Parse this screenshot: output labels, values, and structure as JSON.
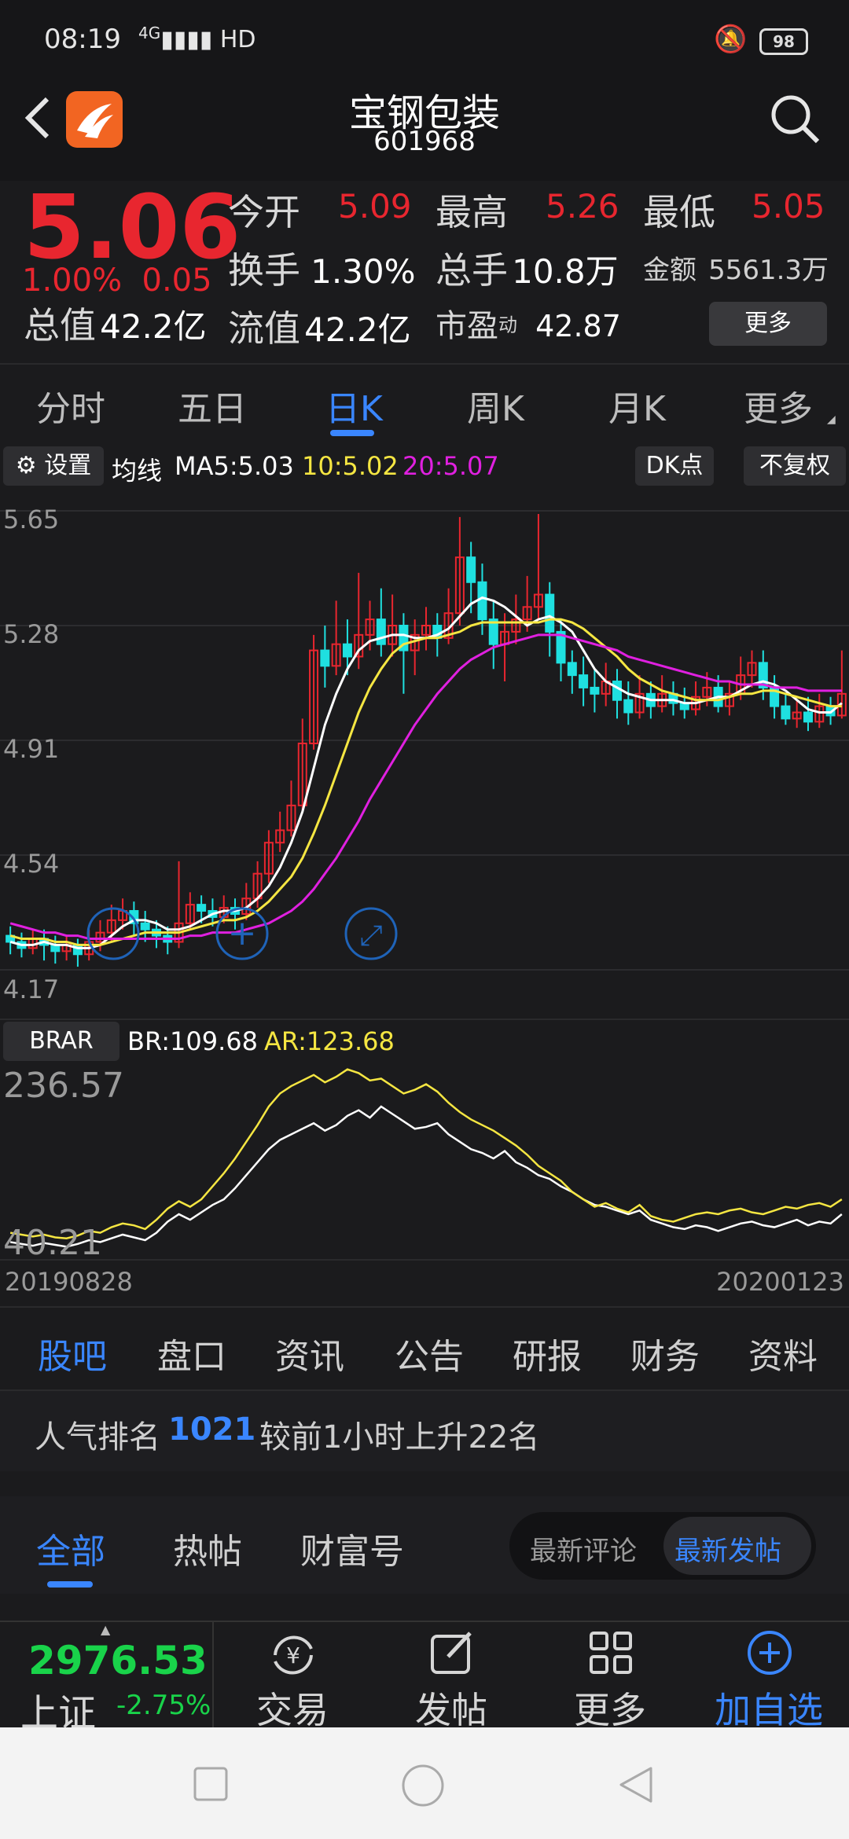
{
  "status": {
    "time": "08:19",
    "network": "4G",
    "signal_extra": "HD",
    "battery": "98"
  },
  "header": {
    "name": "宝钢包装",
    "code": "601968"
  },
  "quote": {
    "price": "5.06",
    "pct": "1.00%",
    "change": "0.05",
    "open_label": "今开",
    "open": "5.09",
    "high_label": "最高",
    "high": "5.26",
    "low_label": "最低",
    "low": "5.05",
    "turnover_label": "换手",
    "turnover": "1.30%",
    "volume_label": "总手",
    "volume": "10.8万",
    "amount_label": "金额",
    "amount": "5561.3万",
    "mcap_label": "总值",
    "mcap": "42.2亿",
    "float_label": "流值",
    "float": "42.2亿",
    "pe_label": "市盈",
    "pe_sup": "动",
    "pe": "42.87",
    "more": "更多"
  },
  "period_tabs": [
    "分时",
    "五日",
    "日K",
    "周K",
    "月K",
    "更多"
  ],
  "ma_bar": {
    "settings": "设置",
    "label": "均线",
    "ma5": "MA5:5.03",
    "ma10": "10:5.02",
    "ma20": "20:5.07",
    "dk": "DK点",
    "adjust": "不复权",
    "colors": {
      "ma5": "#ffffff",
      "ma10": "#f5e642",
      "ma20": "#e020e0"
    }
  },
  "chart_data": [
    {
      "type": "candlestick",
      "y_ticks": [
        "5.65",
        "5.28",
        "4.91",
        "4.54",
        "4.17"
      ],
      "ylim": [
        4.17,
        5.65
      ],
      "candles": [
        [
          4.28,
          4.26,
          4.31,
          4.22
        ],
        [
          4.26,
          4.24,
          4.29,
          4.21
        ],
        [
          4.24,
          4.27,
          4.3,
          4.22
        ],
        [
          4.27,
          4.25,
          4.3,
          4.2
        ],
        [
          4.25,
          4.23,
          4.28,
          4.19
        ],
        [
          4.23,
          4.25,
          4.28,
          4.2
        ],
        [
          4.25,
          4.22,
          4.27,
          4.18
        ],
        [
          4.22,
          4.26,
          4.3,
          4.2
        ],
        [
          4.26,
          4.29,
          4.33,
          4.23
        ],
        [
          4.29,
          4.33,
          4.38,
          4.26
        ],
        [
          4.33,
          4.36,
          4.4,
          4.3
        ],
        [
          4.36,
          4.32,
          4.39,
          4.28
        ],
        [
          4.32,
          4.3,
          4.36,
          4.26
        ],
        [
          4.3,
          4.28,
          4.33,
          4.24
        ],
        [
          4.28,
          4.26,
          4.31,
          4.22
        ],
        [
          4.26,
          4.32,
          4.52,
          4.24
        ],
        [
          4.32,
          4.38,
          4.42,
          4.3
        ],
        [
          4.38,
          4.36,
          4.41,
          4.32
        ],
        [
          4.36,
          4.34,
          4.4,
          4.31
        ],
        [
          4.34,
          4.37,
          4.41,
          4.32
        ],
        [
          4.37,
          4.35,
          4.4,
          4.3
        ],
        [
          4.35,
          4.4,
          4.45,
          4.33
        ],
        [
          4.4,
          4.48,
          4.52,
          4.37
        ],
        [
          4.48,
          4.58,
          4.62,
          4.45
        ],
        [
          4.58,
          4.62,
          4.68,
          4.55
        ],
        [
          4.62,
          4.7,
          4.78,
          4.6
        ],
        [
          4.7,
          4.9,
          4.98,
          4.68
        ],
        [
          4.9,
          5.2,
          5.25,
          4.88
        ],
        [
          5.2,
          5.15,
          5.28,
          5.08
        ],
        [
          5.15,
          5.22,
          5.36,
          5.12
        ],
        [
          5.22,
          5.18,
          5.3,
          5.12
        ],
        [
          5.18,
          5.25,
          5.45,
          5.14
        ],
        [
          5.25,
          5.3,
          5.36,
          5.2
        ],
        [
          5.3,
          5.22,
          5.4,
          5.18
        ],
        [
          5.22,
          5.28,
          5.38,
          5.18
        ],
        [
          5.28,
          5.2,
          5.32,
          5.06
        ],
        [
          5.2,
          5.25,
          5.3,
          5.12
        ],
        [
          5.25,
          5.28,
          5.34,
          5.2
        ],
        [
          5.28,
          5.24,
          5.32,
          5.18
        ],
        [
          5.24,
          5.32,
          5.4,
          5.22
        ],
        [
          5.32,
          5.5,
          5.63,
          5.28
        ],
        [
          5.5,
          5.42,
          5.55,
          5.32
        ],
        [
          5.42,
          5.3,
          5.48,
          5.25
        ],
        [
          5.3,
          5.22,
          5.36,
          5.14
        ],
        [
          5.22,
          5.26,
          5.32,
          5.1
        ],
        [
          5.26,
          5.3,
          5.38,
          5.22
        ],
        [
          5.3,
          5.34,
          5.44,
          5.26
        ],
        [
          5.34,
          5.38,
          5.64,
          5.3
        ],
        [
          5.38,
          5.26,
          5.42,
          5.18
        ],
        [
          5.26,
          5.16,
          5.3,
          5.1
        ],
        [
          5.16,
          5.12,
          5.2,
          5.06
        ],
        [
          5.12,
          5.08,
          5.18,
          5.02
        ],
        [
          5.08,
          5.06,
          5.14,
          5.0
        ],
        [
          5.06,
          5.1,
          5.16,
          5.02
        ],
        [
          5.1,
          5.04,
          5.14,
          4.98
        ],
        [
          5.04,
          5.0,
          5.1,
          4.96
        ],
        [
          5.0,
          5.06,
          5.12,
          4.98
        ],
        [
          5.06,
          5.02,
          5.1,
          4.98
        ],
        [
          5.02,
          5.06,
          5.12,
          5.0
        ],
        [
          5.06,
          5.03,
          5.1,
          4.99
        ],
        [
          5.03,
          5.01,
          5.08,
          4.98
        ],
        [
          5.01,
          5.05,
          5.1,
          4.99
        ],
        [
          5.05,
          5.08,
          5.13,
          5.02
        ],
        [
          5.08,
          5.02,
          5.12,
          5.0
        ],
        [
          5.02,
          5.06,
          5.1,
          4.99
        ],
        [
          5.06,
          5.12,
          5.18,
          5.04
        ],
        [
          5.12,
          5.16,
          5.2,
          5.08
        ],
        [
          5.16,
          5.08,
          5.2,
          5.04
        ],
        [
          5.08,
          5.02,
          5.12,
          4.98
        ],
        [
          5.02,
          4.98,
          5.06,
          4.96
        ],
        [
          4.98,
          5.0,
          5.04,
          4.95
        ],
        [
          5.0,
          4.97,
          5.05,
          4.94
        ],
        [
          4.97,
          5.02,
          5.06,
          4.95
        ],
        [
          5.02,
          4.99,
          5.05,
          4.96
        ],
        [
          4.99,
          5.06,
          5.2,
          4.98
        ]
      ],
      "series": [
        {
          "name": "MA5",
          "color": "#ffffff",
          "values": [
            4.26,
            4.25,
            4.25,
            4.26,
            4.25,
            4.25,
            4.24,
            4.24,
            4.25,
            4.28,
            4.31,
            4.33,
            4.33,
            4.32,
            4.3,
            4.3,
            4.31,
            4.33,
            4.35,
            4.36,
            4.36,
            4.37,
            4.4,
            4.44,
            4.5,
            4.58,
            4.68,
            4.82,
            4.96,
            5.06,
            5.14,
            5.2,
            5.23,
            5.24,
            5.25,
            5.25,
            5.24,
            5.24,
            5.25,
            5.27,
            5.31,
            5.35,
            5.37,
            5.36,
            5.34,
            5.31,
            5.28,
            5.3,
            5.31,
            5.29,
            5.26,
            5.2,
            5.14,
            5.1,
            5.08,
            5.06,
            5.05,
            5.04,
            5.04,
            5.04,
            5.03,
            5.03,
            5.04,
            5.05,
            5.05,
            5.07,
            5.09,
            5.1,
            5.09,
            5.07,
            5.04,
            5.01,
            5.0,
            5.0,
            5.03
          ]
        },
        {
          "name": "MA10",
          "color": "#f5e642",
          "values": [
            4.28,
            4.27,
            4.27,
            4.27,
            4.26,
            4.26,
            4.25,
            4.25,
            4.25,
            4.26,
            4.27,
            4.28,
            4.29,
            4.29,
            4.29,
            4.29,
            4.3,
            4.31,
            4.32,
            4.33,
            4.33,
            4.34,
            4.36,
            4.39,
            4.43,
            4.47,
            4.53,
            4.61,
            4.7,
            4.8,
            4.9,
            5.0,
            5.08,
            5.14,
            5.19,
            5.22,
            5.23,
            5.24,
            5.24,
            5.25,
            5.26,
            5.28,
            5.29,
            5.29,
            5.29,
            5.29,
            5.29,
            5.29,
            5.3,
            5.3,
            5.29,
            5.27,
            5.24,
            5.21,
            5.18,
            5.14,
            5.11,
            5.09,
            5.07,
            5.06,
            5.05,
            5.04,
            5.04,
            5.04,
            5.05,
            5.06,
            5.06,
            5.07,
            5.07,
            5.06,
            5.05,
            5.04,
            5.03,
            5.02,
            5.02
          ]
        },
        {
          "name": "MA20",
          "color": "#e020e0",
          "values": [
            4.32,
            4.31,
            4.3,
            4.29,
            4.29,
            4.28,
            4.28,
            4.27,
            4.27,
            4.27,
            4.27,
            4.27,
            4.27,
            4.27,
            4.27,
            4.27,
            4.28,
            4.28,
            4.29,
            4.29,
            4.29,
            4.3,
            4.31,
            4.32,
            4.34,
            4.36,
            4.39,
            4.43,
            4.48,
            4.53,
            4.59,
            4.65,
            4.72,
            4.78,
            4.84,
            4.9,
            4.96,
            5.01,
            5.06,
            5.1,
            5.14,
            5.17,
            5.19,
            5.21,
            5.22,
            5.23,
            5.24,
            5.25,
            5.25,
            5.25,
            5.24,
            5.23,
            5.22,
            5.21,
            5.2,
            5.18,
            5.17,
            5.16,
            5.15,
            5.14,
            5.13,
            5.12,
            5.11,
            5.1,
            5.1,
            5.09,
            5.09,
            5.09,
            5.08,
            5.08,
            5.08,
            5.07,
            5.07,
            5.07,
            5.07
          ]
        }
      ]
    },
    {
      "type": "line",
      "indicator": "BRAR",
      "y_ticks": [
        "236.57",
        "40.21"
      ],
      "ylim": [
        40.21,
        236.57
      ],
      "series": [
        {
          "name": "BR",
          "color": "#ffffff",
          "values": [
            50,
            48,
            46,
            49,
            47,
            45,
            48,
            52,
            50,
            54,
            58,
            55,
            52,
            60,
            72,
            80,
            74,
            82,
            90,
            96,
            108,
            122,
            136,
            150,
            160,
            166,
            172,
            178,
            170,
            176,
            186,
            192,
            184,
            196,
            188,
            180,
            172,
            174,
            178,
            166,
            158,
            150,
            146,
            140,
            148,
            136,
            130,
            122,
            118,
            110,
            104,
            96,
            90,
            88,
            84,
            80,
            84,
            74,
            70,
            66,
            64,
            68,
            66,
            62,
            66,
            70,
            72,
            68,
            66,
            70,
            74,
            68,
            72,
            70,
            80
          ]
        },
        {
          "name": "AR",
          "color": "#f5e642",
          "values": [
            60,
            58,
            56,
            58,
            55,
            54,
            57,
            62,
            60,
            66,
            70,
            68,
            64,
            74,
            86,
            94,
            88,
            96,
            110,
            124,
            140,
            158,
            176,
            196,
            210,
            218,
            224,
            230,
            222,
            228,
            236,
            232,
            224,
            226,
            218,
            210,
            214,
            220,
            212,
            200,
            190,
            182,
            176,
            170,
            162,
            154,
            144,
            132,
            124,
            116,
            104,
            96,
            88,
            92,
            86,
            82,
            90,
            78,
            74,
            72,
            76,
            80,
            82,
            80,
            84,
            86,
            82,
            80,
            84,
            88,
            86,
            90,
            92,
            88,
            96
          ]
        }
      ]
    }
  ],
  "kchart_buttons": {
    "add": "+",
    "expand": "⤢"
  },
  "brar": {
    "label": "BRAR",
    "br": "BR:109.68",
    "ar": "AR:123.68"
  },
  "dates": {
    "start": "20190828",
    "end": "20200123"
  },
  "content_tabs": [
    "股吧",
    "盘口",
    "资讯",
    "公告",
    "研报",
    "财务",
    "资料"
  ],
  "rank": {
    "prefix": "人气排名",
    "rank": "1021",
    "suffix": "较前1小时上升22名"
  },
  "sub_tabs": [
    "全部",
    "热帖",
    "财富号"
  ],
  "sort_toggle": {
    "latest_comment": "最新评论",
    "latest_post": "最新发帖"
  },
  "bottom": {
    "index_value": "2976.53",
    "index_name": "上证",
    "index_change": "-2.75%",
    "trade": "交易",
    "post": "发帖",
    "more": "更多",
    "add_watch": "加自选"
  }
}
